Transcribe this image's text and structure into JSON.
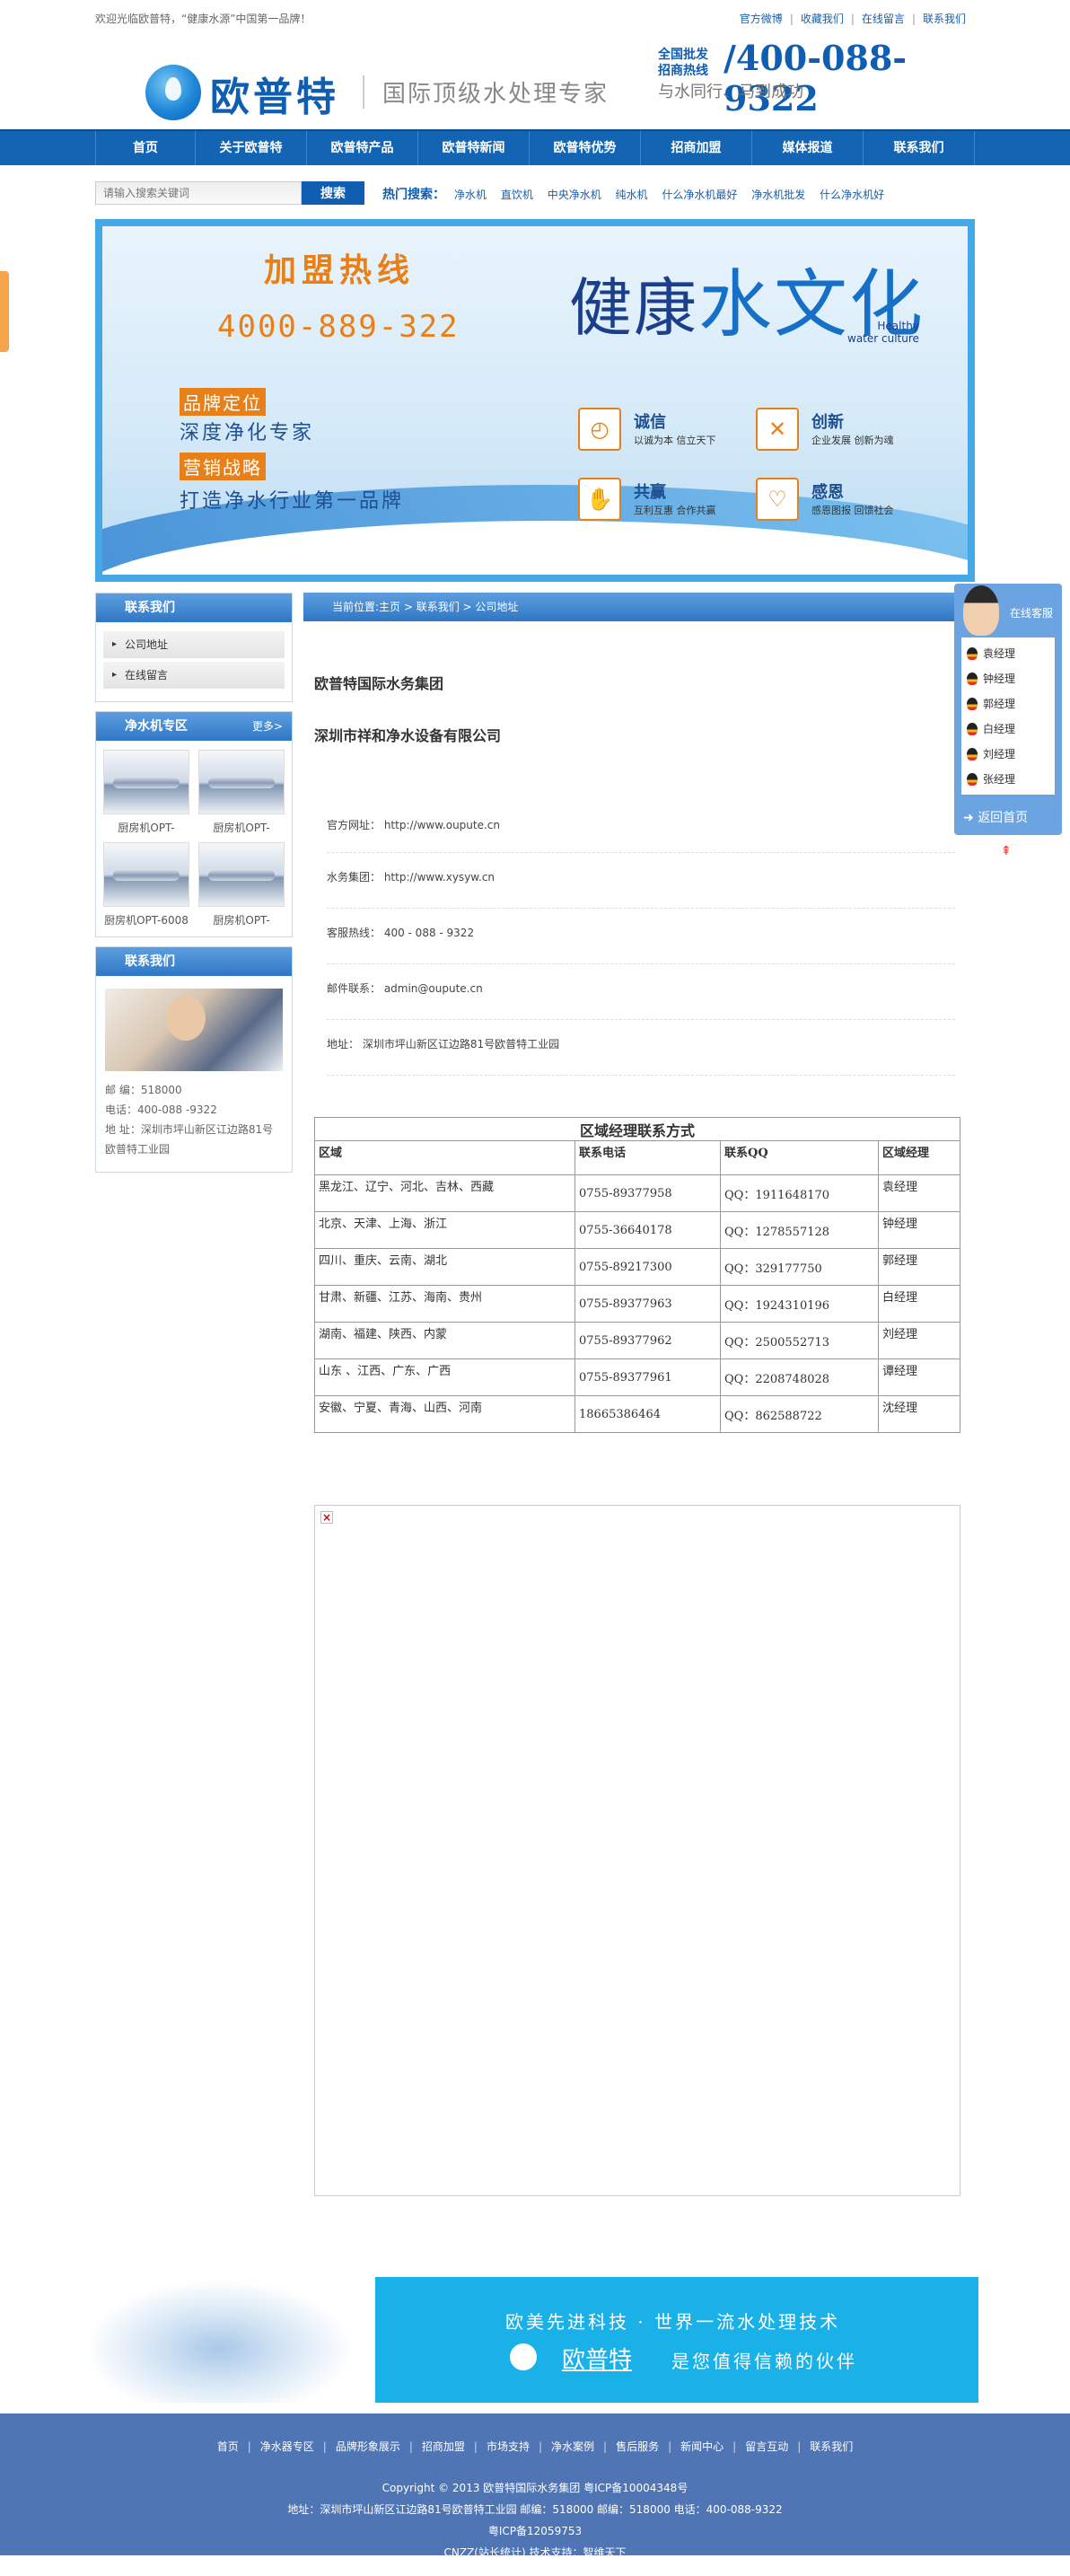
{
  "topbar": {
    "welcome": "欢迎光临欧普特，“健康水源”中国第一品牌！",
    "links": [
      "官方微博",
      "收藏我们",
      "在线留言",
      "联系我们"
    ]
  },
  "header": {
    "logo": "欧普特",
    "slogan": "国际顶级水处理专家",
    "hotline_label_1": "全国批发",
    "hotline_label_2": "招商热线",
    "hotline": "400-088-9322",
    "tagline": "与水同行、马到成功"
  },
  "nav": [
    "首页",
    "关于欧普特",
    "欧普特产品",
    "欧普特新闻",
    "欧普特优势",
    "招商加盟",
    "媒体报道",
    "联系我们"
  ],
  "search": {
    "placeholder": "请输入搜索关键词",
    "button": "搜索",
    "hot_label": "热门搜索：",
    "hot_words": [
      "净水机",
      "直饮机",
      "中央净水机",
      "纯水机",
      "什么净水机最好",
      "净水机批发",
      "什么净水机好"
    ]
  },
  "banner": {
    "hot_title": "加盟热线",
    "hot_number": "4000-889-322",
    "tag1": "品牌定位",
    "line1": "深度净化专家",
    "tag2": "营销战略",
    "line2": "打造净水行业第一品牌",
    "title_a": "健康",
    "title_b": "水文化",
    "healthy_1": "Healthy",
    "healthy_2": "water culture",
    "values": [
      {
        "title": "诚信",
        "desc": "以诚为本 信立天下",
        "icon": "clock-icon"
      },
      {
        "title": "创新",
        "desc": "企业发展 创新为魂",
        "icon": "tools-icon"
      },
      {
        "title": "共赢",
        "desc": "互利互惠 合作共赢",
        "icon": "handshake-icon"
      },
      {
        "title": "感恩",
        "desc": "感恩图报 回馈社会",
        "icon": "heart-icon"
      }
    ]
  },
  "sidebar": {
    "contact_head": "联系我们",
    "menu": [
      "公司地址",
      "在线留言"
    ],
    "products_head": "净水机专区",
    "more": "更多>",
    "products": [
      "厨房机OPT-",
      "厨房机OPT-",
      "厨房机OPT-6008",
      "厨房机OPT-"
    ],
    "contact_head2": "联系我们",
    "zip": "邮 编：518000",
    "tel": "电话：400-088 -9322",
    "addr": "地 址：深圳市坪山新区讧边路81号欧普特工业园"
  },
  "content": {
    "breadcrumb": "当前位置:主页 > 联系我们 > 公司地址",
    "company1": "欧普特国际水务集团",
    "company2": "深圳市祥和净水设备有限公司",
    "info": [
      "官方网址： http://www.oupute.cn",
      "水务集团： http://www.xysyw.cn",
      "客服热线： 400 - 088 - 9322",
      "邮件联系： admin@oupute.cn",
      "地址： 深圳市坪山新区讧边路81号欧普特工业园"
    ]
  },
  "region_table": {
    "caption": "区域经理联系方式",
    "headers": [
      "区域",
      "联系电话",
      "联系QQ",
      "区域经理"
    ],
    "rows": [
      [
        "黑龙江、辽宁、河北、吉林、西藏",
        "0755-89377958",
        "QQ：1911648170",
        "袁经理"
      ],
      [
        "北京、天津、上海、浙江",
        "0755-36640178",
        "QQ：1278557128",
        "钟经理"
      ],
      [
        "四川、重庆、云南、湖北",
        "0755-89217300",
        "QQ：329177750",
        "郭经理"
      ],
      [
        "甘肃、新疆、江苏、海南、贵州",
        "0755-89377963",
        "QQ：1924310196",
        "白经理"
      ],
      [
        "湖南、福建、陕西、内蒙",
        "0755-89377962",
        "QQ：2500552713",
        "刘经理"
      ],
      [
        "山东 、江西、广东、广西",
        "0755-89377961",
        "QQ：2208748028",
        "谭经理"
      ],
      [
        "安徽、宁夏、青海、山西、河南",
        "18665386464",
        "QQ：862588722",
        "沈经理"
      ]
    ]
  },
  "qq_panel": {
    "label": "在线客服",
    "managers": [
      "袁经理",
      "钟经理",
      "郭经理",
      "白经理",
      "刘经理",
      "张经理"
    ],
    "back": "返回首页"
  },
  "foot_ad": {
    "line1": "欧美先进科技 · 世界一流水处理技术",
    "brand": "欧普特",
    "line2": "是您值得信赖的伙伴"
  },
  "footer": {
    "links": [
      "首页",
      "净水器专区",
      "品牌形象展示",
      "招商加盟",
      "市场支持",
      "净水案例",
      "售后服务",
      "新闻中心",
      "留言互动",
      "联系我们"
    ],
    "copyright": "Copyright © 2013 欧普特国际水务集团 粤ICP备10004348号",
    "address": "地址：深圳市坪山新区讧边路81号欧普特工业园 邮编：518000 邮编：518000 电话：400-088-9322",
    "icp": "粤ICP备12059753",
    "cnzz": "CNZZ(站长统计) 技术支持：智维天下"
  }
}
